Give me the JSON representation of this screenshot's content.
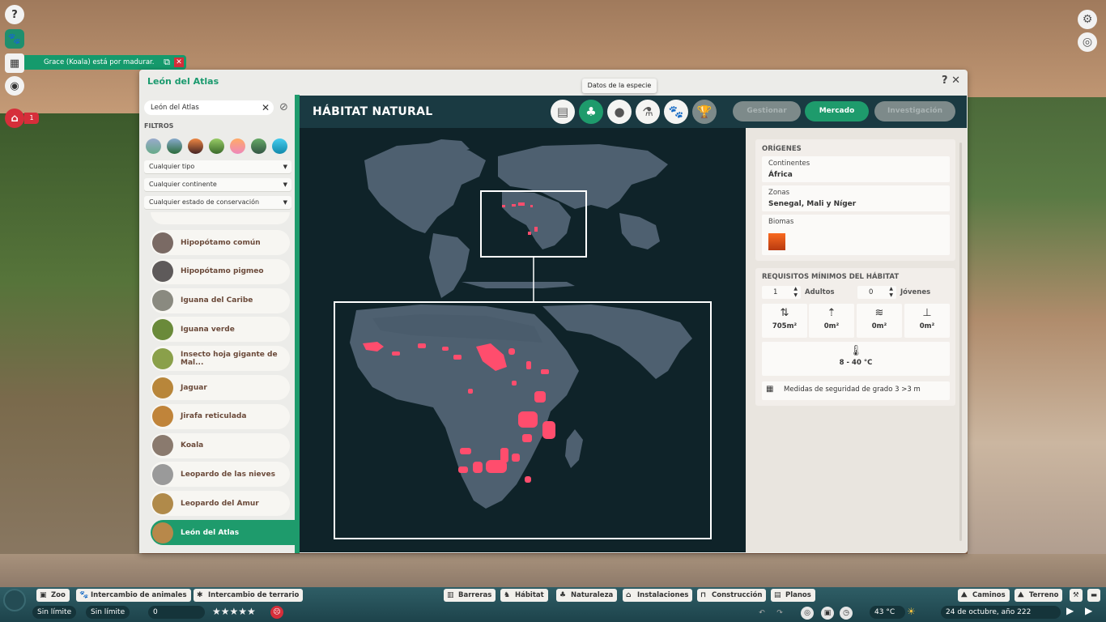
{
  "notification": {
    "text": "Grace (Koala) está por madurar."
  },
  "left_rail": {
    "warning_count": "1"
  },
  "window": {
    "title": "León del Atlas",
    "help": "?",
    "close": "✕"
  },
  "tooltip": "Datos de la especie",
  "search": {
    "value": "León del Atlas"
  },
  "filters_label": "FILTROS",
  "dropdowns": [
    "Cualquier tipo",
    "Cualquier continente",
    "Cualquier estado de conservación"
  ],
  "species": [
    {
      "name": "Hipopótamo común",
      "color": "#7a6a64"
    },
    {
      "name": "Hipopótamo pigmeo",
      "color": "#5e5a5a"
    },
    {
      "name": "Iguana del Caribe",
      "color": "#8a8a80"
    },
    {
      "name": "Iguana verde",
      "color": "#6a8a3a"
    },
    {
      "name": "Insecto hoja gigante de Mal...",
      "color": "#8aa04a"
    },
    {
      "name": "Jaguar",
      "color": "#b8863a"
    },
    {
      "name": "Jirafa reticulada",
      "color": "#c0843a"
    },
    {
      "name": "Koala",
      "color": "#8a7a6e"
    },
    {
      "name": "Leopardo de las nieves",
      "color": "#9a9a9a"
    },
    {
      "name": "Leopardo del Amur",
      "color": "#b08a4a"
    },
    {
      "name": "León del Atlas",
      "color": "#b8884a"
    }
  ],
  "content": {
    "title": "HÁBITAT NATURAL"
  },
  "actions": {
    "manage": "Gestionar",
    "market": "Mercado",
    "research": "Investigación"
  },
  "origins": {
    "section": "ORÍGENES",
    "continents_label": "Continentes",
    "continents_value": "África",
    "zones_label": "Zonas",
    "zones_value": "Senegal, Mali y Níger",
    "biomes_label": "Biomas"
  },
  "requirements": {
    "section": "REQUISITOS MÍNIMOS DEL HÁBITAT",
    "adults_value": "1",
    "adults_label": "Adultos",
    "young_value": "0",
    "young_label": "Jóvenes",
    "land": "705m²",
    "climb": "0m²",
    "water": "0m²",
    "deep_water": "0m²",
    "temperature": "8 - 40 °C",
    "security": "Medidas de seguridad de grado 3 >3 m"
  },
  "toolbar": {
    "left": [
      "Zoo",
      "Intercambio de animales",
      "Intercambio de terrario"
    ],
    "center": [
      "Barreras",
      "Hábitat",
      "Naturaleza",
      "Instalaciones",
      "Construcción",
      "Planos"
    ],
    "right": [
      "Caminos",
      "Terreno"
    ]
  },
  "status": {
    "money": "Sin límite",
    "research": "Sin límite",
    "guests": "0",
    "temperature": "43 °C",
    "date": "24 de octubre, año 222",
    "stars_rating": "4.5/5"
  },
  "colors": {
    "accent": "#1e9b6c",
    "range": "#ff4d6d",
    "land": "#4e6070",
    "map_bg": "#0f2329"
  }
}
